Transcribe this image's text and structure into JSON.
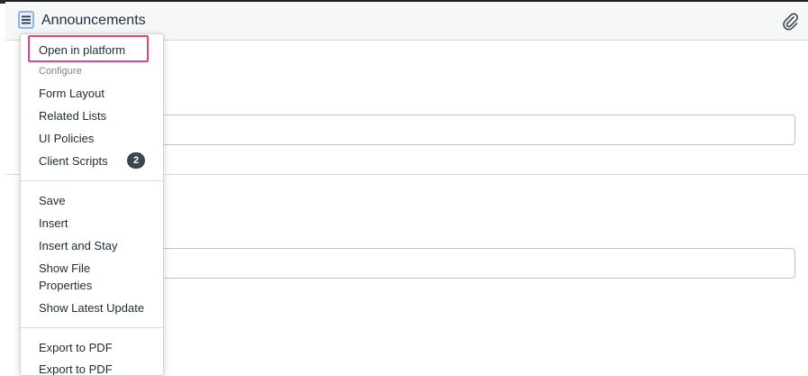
{
  "header": {
    "title": "Announcements",
    "menu_icon": "hamburger-menu-icon",
    "attachment_icon": "paperclip-icon"
  },
  "menu": {
    "open_in_platform": "Open in platform",
    "configure_heading": "Configure",
    "form_layout": "Form Layout",
    "related_lists": "Related Lists",
    "ui_policies": "UI Policies",
    "client_scripts": "Client Scripts",
    "client_scripts_count": "2",
    "save": "Save",
    "insert": "Insert",
    "insert_and_stay": "Insert and Stay",
    "show_file_properties_line1": "Show File",
    "show_file_properties_line2": "Properties",
    "show_latest_update": "Show Latest Update",
    "export_to_pdf_1": "Export to PDF",
    "export_to_pdf_2": "Export to PDF"
  },
  "colors": {
    "highlight_border": "#e0457b",
    "menu_button_border": "#8fb5e8",
    "badge_bg": "#3c4650"
  }
}
